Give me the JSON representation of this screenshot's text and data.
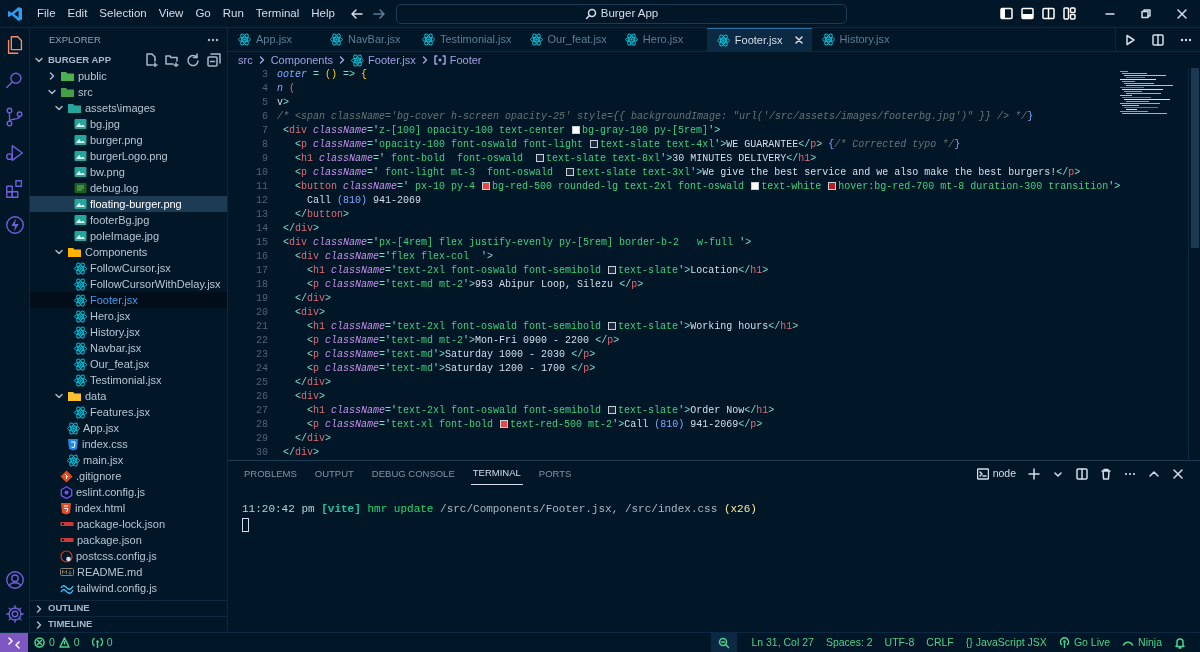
{
  "menu": [
    "File",
    "Edit",
    "Selection",
    "View",
    "Go",
    "Run",
    "Terminal",
    "Help"
  ],
  "command_center": {
    "label": "Burger App"
  },
  "activity_bar": [
    {
      "kind": "explorer",
      "selected": true
    },
    {
      "kind": "search",
      "selected": false
    },
    {
      "kind": "source",
      "selected": false
    },
    {
      "kind": "debug",
      "selected": false
    },
    {
      "kind": "extensions",
      "selected": false
    },
    {
      "kind": "lightning",
      "selected": false
    }
  ],
  "activity_bottom": [
    {
      "kind": "account"
    },
    {
      "kind": "settings"
    }
  ],
  "sidebar": {
    "title": "EXPLORER",
    "project": "BURGER APP",
    "tree": [
      {
        "label": "public",
        "kind": "folder",
        "color": "#4caf50",
        "expanded": false,
        "selected": false,
        "active": false
      },
      {
        "label": "src",
        "kind": "folder",
        "color": "#43a047",
        "expanded": true,
        "selected": false,
        "active": false,
        "children": [
          {
            "label": "assets\\images",
            "kind": "folder",
            "color": "#26a69a",
            "expanded": true,
            "selected": false,
            "active": false,
            "children": [
              {
                "label": "bg.jpg",
                "kind": "image",
                "selected": false,
                "active": false
              },
              {
                "label": "burger.png",
                "kind": "image",
                "selected": false,
                "active": false
              },
              {
                "label": "burgerLogo.png",
                "kind": "image",
                "selected": false,
                "active": false
              },
              {
                "label": "bw.png",
                "kind": "image",
                "selected": false,
                "active": false
              },
              {
                "label": "debug.log",
                "kind": "log",
                "selected": false,
                "active": false
              },
              {
                "label": "floating-burger.png",
                "kind": "image",
                "selected": true,
                "active": false
              },
              {
                "label": "footerBg.jpg",
                "kind": "image",
                "selected": false,
                "active": false
              },
              {
                "label": "poleImage.jpg",
                "kind": "image",
                "selected": false,
                "active": false
              }
            ]
          },
          {
            "label": "Components",
            "kind": "folder",
            "color": "#ffb300",
            "expanded": true,
            "selected": false,
            "active": false,
            "children": [
              {
                "label": "FollowCursor.jsx",
                "kind": "react",
                "selected": false,
                "active": false
              },
              {
                "label": "FollowCursorWithDelay.jsx",
                "kind": "react",
                "selected": false,
                "active": false
              },
              {
                "label": "Footer.jsx",
                "kind": "react",
                "selected": false,
                "active": true
              },
              {
                "label": "Hero.jsx",
                "kind": "react",
                "selected": false,
                "active": false
              },
              {
                "label": "History.jsx",
                "kind": "react",
                "selected": false,
                "active": false
              },
              {
                "label": "Navbar.jsx",
                "kind": "react",
                "selected": false,
                "active": false
              },
              {
                "label": "Our_feat.jsx",
                "kind": "react",
                "selected": false,
                "active": false
              },
              {
                "label": "Testimonial.jsx",
                "kind": "react",
                "selected": false,
                "active": false
              }
            ]
          },
          {
            "label": "data",
            "kind": "folder",
            "color": "#fbc02d",
            "expanded": true,
            "selected": false,
            "active": false,
            "children": [
              {
                "label": "Features.jsx",
                "kind": "react",
                "selected": false,
                "active": false
              }
            ]
          },
          {
            "label": "App.jsx",
            "kind": "react",
            "selected": false,
            "active": false
          },
          {
            "label": "index.css",
            "kind": "css",
            "selected": false,
            "active": false
          },
          {
            "label": "main.jsx",
            "kind": "react",
            "selected": false,
            "active": false
          }
        ]
      },
      {
        "label": ".gitignore",
        "kind": "git",
        "selected": false,
        "active": false
      },
      {
        "label": "eslint.config.js",
        "kind": "eslint",
        "selected": false,
        "active": false
      },
      {
        "label": "index.html",
        "kind": "html",
        "selected": false,
        "active": false
      },
      {
        "label": "package-lock.json",
        "kind": "npm",
        "selected": false,
        "active": false
      },
      {
        "label": "package.json",
        "kind": "npm",
        "selected": false,
        "active": false
      },
      {
        "label": "postcss.config.js",
        "kind": "postcss",
        "selected": false,
        "active": false
      },
      {
        "label": "README.md",
        "kind": "markdown",
        "selected": false,
        "active": false
      },
      {
        "label": "tailwind.config.js",
        "kind": "tailwind",
        "selected": false,
        "active": false
      }
    ],
    "sections": [
      {
        "label": "OUTLINE",
        "expanded": false
      },
      {
        "label": "TIMELINE",
        "expanded": false
      }
    ]
  },
  "tabs": [
    {
      "label": "App.jsx",
      "selected": false
    },
    {
      "label": "NavBar.jsx",
      "selected": false
    },
    {
      "label": "Testimonial.jsx",
      "selected": false
    },
    {
      "label": "Our_feat.jsx",
      "selected": false
    },
    {
      "label": "Hero.jsx",
      "selected": false
    },
    {
      "label": "Footer.jsx",
      "selected": true
    },
    {
      "label": "History.jsx",
      "selected": false
    }
  ],
  "breadcrumb": [
    {
      "kind": "folder",
      "label": "src"
    },
    {
      "kind": "folder",
      "label": "Components"
    },
    {
      "kind": "file",
      "label": "Footer.jsx"
    },
    {
      "kind": "symbol",
      "label": "Footer"
    }
  ],
  "editor": {
    "lines": [
      {
        "number": "3",
        "tokens": [
          {
            "kind": "name",
            "text": "ooter"
          },
          {
            "kind": "punct",
            "text": " = "
          },
          {
            "kind": "paren",
            "text": "()"
          },
          {
            "kind": "punct",
            "text": " => "
          },
          {
            "kind": "paren",
            "text": "{"
          }
        ]
      },
      {
        "number": "4",
        "tokens": [
          {
            "kind": "name",
            "text": "n"
          },
          {
            "kind": "tag",
            "text": " ("
          }
        ]
      },
      {
        "number": "5",
        "tokens": [
          {
            "kind": "text",
            "text": "v"
          },
          {
            "kind": "punct",
            "text": ">"
          }
        ]
      },
      {
        "number": "6",
        "tokens": [
          {
            "kind": "comment",
            "text": "/* <span className='bg-cover h-screen opacity-25' style={{ backgroundImage: \"url('/src/assets/images/footerbg.jpg')\" }} /> */"
          },
          {
            "kind": "brace",
            "text": "}"
          }
        ]
      },
      {
        "number": "7",
        "tokens": [
          {
            "kind": "punct",
            "text": " <"
          },
          {
            "kind": "tag",
            "text": "div"
          },
          {
            "kind": "attr",
            "text": " className"
          },
          {
            "kind": "punct",
            "text": "='"
          },
          {
            "kind": "string",
            "text": "z-[100] opacity-100 text-center "
          },
          {
            "kind": "swatch",
            "color": "#ffffff"
          },
          {
            "kind": "string",
            "text": "bg-gray-100 py-[5rem]"
          },
          {
            "kind": "punct",
            "text": "'>"
          }
        ]
      },
      {
        "number": "8",
        "tokens": [
          {
            "kind": "punct",
            "text": "   <"
          },
          {
            "kind": "tag",
            "text": "p"
          },
          {
            "kind": "attr",
            "text": " className"
          },
          {
            "kind": "punct",
            "text": "='"
          },
          {
            "kind": "string",
            "text": "opacity-100 font-oswald font-light "
          },
          {
            "kind": "swatch",
            "color": "#1e293b"
          },
          {
            "kind": "string",
            "text": "text-slate text-4xl"
          },
          {
            "kind": "punct",
            "text": "'>"
          },
          {
            "kind": "text",
            "text": "WE GUARANTEE"
          },
          {
            "kind": "punct",
            "text": "</"
          },
          {
            "kind": "tag",
            "text": "p"
          },
          {
            "kind": "punct",
            "text": "> "
          },
          {
            "kind": "brace",
            "text": "{"
          },
          {
            "kind": "comment",
            "text": "/* Corrected typo */"
          },
          {
            "kind": "brace",
            "text": "}"
          }
        ]
      },
      {
        "number": "9",
        "tokens": [
          {
            "kind": "punct",
            "text": "   <"
          },
          {
            "kind": "tag",
            "text": "h1"
          },
          {
            "kind": "attr",
            "text": " className"
          },
          {
            "kind": "punct",
            "text": "='"
          },
          {
            "kind": "string",
            "text": " font-bold  font-oswald  "
          },
          {
            "kind": "swatch",
            "color": "#1e293b"
          },
          {
            "kind": "string",
            "text": "text-slate text-8xl"
          },
          {
            "kind": "punct",
            "text": "'>"
          },
          {
            "kind": "text",
            "text": "30 MINUTES DELIVERY"
          },
          {
            "kind": "punct",
            "text": "</"
          },
          {
            "kind": "tag",
            "text": "h1"
          },
          {
            "kind": "punct",
            "text": ">"
          }
        ]
      },
      {
        "number": "10",
        "tokens": [
          {
            "kind": "punct",
            "text": "   <"
          },
          {
            "kind": "tag",
            "text": "p"
          },
          {
            "kind": "attr",
            "text": " className"
          },
          {
            "kind": "punct",
            "text": "='"
          },
          {
            "kind": "string",
            "text": " font-light mt-3  font-oswald  "
          },
          {
            "kind": "swatch",
            "color": "#1e293b"
          },
          {
            "kind": "string",
            "text": "text-slate text-3xl"
          },
          {
            "kind": "punct",
            "text": "'>"
          },
          {
            "kind": "text",
            "text": "We give the best service and we also make the best burgers!"
          },
          {
            "kind": "punct",
            "text": "</"
          },
          {
            "kind": "tag",
            "text": "p"
          },
          {
            "kind": "punct",
            "text": ">"
          }
        ]
      },
      {
        "number": "11",
        "tokens": [
          {
            "kind": "punct",
            "text": "   <"
          },
          {
            "kind": "tag",
            "text": "button"
          },
          {
            "kind": "attr",
            "text": " className"
          },
          {
            "kind": "punct",
            "text": "='"
          },
          {
            "kind": "string",
            "text": " px-10 py-4 "
          },
          {
            "kind": "swatch",
            "color": "#ef4444"
          },
          {
            "kind": "string",
            "text": "bg-red-500 rounded-lg text-2xl font-oswald "
          },
          {
            "kind": "swatch",
            "color": "#ffffff"
          },
          {
            "kind": "string",
            "text": "text-white "
          },
          {
            "kind": "swatch",
            "color": "#b91c1c"
          },
          {
            "kind": "string",
            "text": "hover:bg-red-700 mt-8 duration-300 transition"
          },
          {
            "kind": "punct",
            "text": "'>"
          }
        ]
      },
      {
        "number": "12",
        "tokens": [
          {
            "kind": "text",
            "text": "     Call "
          },
          {
            "kind": "brace",
            "text": "(810)"
          },
          {
            "kind": "text",
            "text": " 941-2069"
          }
        ]
      },
      {
        "number": "13",
        "tokens": [
          {
            "kind": "punct",
            "text": "   </"
          },
          {
            "kind": "tag",
            "text": "button"
          },
          {
            "kind": "punct",
            "text": ">"
          }
        ]
      },
      {
        "number": "14",
        "tokens": [
          {
            "kind": "punct",
            "text": " </"
          },
          {
            "kind": "tag",
            "text": "div"
          },
          {
            "kind": "punct",
            "text": ">"
          }
        ]
      },
      {
        "number": "15",
        "tokens": [
          {
            "kind": "punct",
            "text": " <"
          },
          {
            "kind": "tag",
            "text": "div"
          },
          {
            "kind": "attr",
            "text": " className"
          },
          {
            "kind": "punct",
            "text": "='"
          },
          {
            "kind": "string",
            "text": "px-[4rem] flex justify-evenly py-[5rem] border-b-2   w-full "
          },
          {
            "kind": "punct",
            "text": "'>"
          }
        ]
      },
      {
        "number": "16",
        "tokens": [
          {
            "kind": "punct",
            "text": "   <"
          },
          {
            "kind": "tag",
            "text": "div"
          },
          {
            "kind": "attr",
            "text": " className"
          },
          {
            "kind": "punct",
            "text": "='"
          },
          {
            "kind": "string",
            "text": "flex flex-col  "
          },
          {
            "kind": "punct",
            "text": "'>"
          }
        ]
      },
      {
        "number": "17",
        "tokens": [
          {
            "kind": "punct",
            "text": "     <"
          },
          {
            "kind": "tag",
            "text": "h1"
          },
          {
            "kind": "attr",
            "text": " className"
          },
          {
            "kind": "punct",
            "text": "='"
          },
          {
            "kind": "string",
            "text": "text-2xl font-oswald font-semibold "
          },
          {
            "kind": "swatch",
            "color": "#1e293b"
          },
          {
            "kind": "string",
            "text": "text-slate"
          },
          {
            "kind": "punct",
            "text": "'>"
          },
          {
            "kind": "text",
            "text": "Location"
          },
          {
            "kind": "punct",
            "text": "</"
          },
          {
            "kind": "tag",
            "text": "h1"
          },
          {
            "kind": "punct",
            "text": ">"
          }
        ]
      },
      {
        "number": "18",
        "tokens": [
          {
            "kind": "punct",
            "text": "     <"
          },
          {
            "kind": "tag",
            "text": "p"
          },
          {
            "kind": "attr",
            "text": " className"
          },
          {
            "kind": "punct",
            "text": "='"
          },
          {
            "kind": "string",
            "text": "text-md mt-2"
          },
          {
            "kind": "punct",
            "text": "'>"
          },
          {
            "kind": "text",
            "text": "953 Abipur Loop, Silezu "
          },
          {
            "kind": "punct",
            "text": "</"
          },
          {
            "kind": "tag",
            "text": "p"
          },
          {
            "kind": "punct",
            "text": ">"
          }
        ]
      },
      {
        "number": "19",
        "tokens": [
          {
            "kind": "punct",
            "text": "   </"
          },
          {
            "kind": "tag",
            "text": "div"
          },
          {
            "kind": "punct",
            "text": ">"
          }
        ]
      },
      {
        "number": "20",
        "tokens": [
          {
            "kind": "punct",
            "text": "   <"
          },
          {
            "kind": "tag",
            "text": "div"
          },
          {
            "kind": "punct",
            "text": ">"
          }
        ]
      },
      {
        "number": "21",
        "tokens": [
          {
            "kind": "punct",
            "text": "     <"
          },
          {
            "kind": "tag",
            "text": "h1"
          },
          {
            "kind": "attr",
            "text": " className"
          },
          {
            "kind": "punct",
            "text": "='"
          },
          {
            "kind": "string",
            "text": "text-2xl font-oswald font-semibold "
          },
          {
            "kind": "swatch",
            "color": "#1e293b"
          },
          {
            "kind": "string",
            "text": "text-slate"
          },
          {
            "kind": "punct",
            "text": "'>"
          },
          {
            "kind": "text",
            "text": "Working hours"
          },
          {
            "kind": "punct",
            "text": "</"
          },
          {
            "kind": "tag",
            "text": "h1"
          },
          {
            "kind": "punct",
            "text": ">"
          }
        ]
      },
      {
        "number": "22",
        "tokens": [
          {
            "kind": "punct",
            "text": "     <"
          },
          {
            "kind": "tag",
            "text": "p"
          },
          {
            "kind": "attr",
            "text": " className"
          },
          {
            "kind": "punct",
            "text": "='"
          },
          {
            "kind": "string",
            "text": "text-md mt-2"
          },
          {
            "kind": "punct",
            "text": "'>"
          },
          {
            "kind": "text",
            "text": "Mon-Fri 0900 - 2200 "
          },
          {
            "kind": "punct",
            "text": "</"
          },
          {
            "kind": "tag",
            "text": "p"
          },
          {
            "kind": "punct",
            "text": ">"
          }
        ]
      },
      {
        "number": "23",
        "tokens": [
          {
            "kind": "punct",
            "text": "     <"
          },
          {
            "kind": "tag",
            "text": "p"
          },
          {
            "kind": "attr",
            "text": " className"
          },
          {
            "kind": "punct",
            "text": "='"
          },
          {
            "kind": "string",
            "text": "text-md"
          },
          {
            "kind": "punct",
            "text": "'>"
          },
          {
            "kind": "text",
            "text": "Saturday 1000 - 2030 "
          },
          {
            "kind": "punct",
            "text": "</"
          },
          {
            "kind": "tag",
            "text": "p"
          },
          {
            "kind": "punct",
            "text": ">"
          }
        ]
      },
      {
        "number": "24",
        "tokens": [
          {
            "kind": "punct",
            "text": "     <"
          },
          {
            "kind": "tag",
            "text": "p"
          },
          {
            "kind": "attr",
            "text": " className"
          },
          {
            "kind": "punct",
            "text": "='"
          },
          {
            "kind": "string",
            "text": "text-md"
          },
          {
            "kind": "punct",
            "text": "'>"
          },
          {
            "kind": "text",
            "text": "Saturday 1200 - 1700 "
          },
          {
            "kind": "punct",
            "text": "</"
          },
          {
            "kind": "tag",
            "text": "p"
          },
          {
            "kind": "punct",
            "text": ">"
          }
        ]
      },
      {
        "number": "25",
        "tokens": [
          {
            "kind": "punct",
            "text": "   </"
          },
          {
            "kind": "tag",
            "text": "div"
          },
          {
            "kind": "punct",
            "text": ">"
          }
        ]
      },
      {
        "number": "26",
        "tokens": [
          {
            "kind": "punct",
            "text": "   <"
          },
          {
            "kind": "tag",
            "text": "div"
          },
          {
            "kind": "punct",
            "text": ">"
          }
        ]
      },
      {
        "number": "27",
        "tokens": [
          {
            "kind": "punct",
            "text": "     <"
          },
          {
            "kind": "tag",
            "text": "h1"
          },
          {
            "kind": "attr",
            "text": " className"
          },
          {
            "kind": "punct",
            "text": "='"
          },
          {
            "kind": "string",
            "text": "text-2xl font-oswald font-semibold "
          },
          {
            "kind": "swatch",
            "color": "#1e293b"
          },
          {
            "kind": "string",
            "text": "text-slate"
          },
          {
            "kind": "punct",
            "text": "'>"
          },
          {
            "kind": "text",
            "text": "Order Now"
          },
          {
            "kind": "punct",
            "text": "</"
          },
          {
            "kind": "tag",
            "text": "h1"
          },
          {
            "kind": "punct",
            "text": ">"
          }
        ]
      },
      {
        "number": "28",
        "tokens": [
          {
            "kind": "punct",
            "text": "     <"
          },
          {
            "kind": "tag",
            "text": "p"
          },
          {
            "kind": "attr",
            "text": " className"
          },
          {
            "kind": "punct",
            "text": "='"
          },
          {
            "kind": "string",
            "text": "text-xl font-bold "
          },
          {
            "kind": "swatch",
            "color": "#ef4444"
          },
          {
            "kind": "string",
            "text": "text-red-500 mt-2"
          },
          {
            "kind": "punct",
            "text": "'>"
          },
          {
            "kind": "text",
            "text": "Call "
          },
          {
            "kind": "brace",
            "text": "(810)"
          },
          {
            "kind": "text",
            "text": " 941-2069"
          },
          {
            "kind": "punct",
            "text": "</"
          },
          {
            "kind": "tag",
            "text": "p"
          },
          {
            "kind": "punct",
            "text": ">"
          }
        ]
      },
      {
        "number": "29",
        "tokens": [
          {
            "kind": "punct",
            "text": "   </"
          },
          {
            "kind": "tag",
            "text": "div"
          },
          {
            "kind": "punct",
            "text": ">"
          }
        ]
      },
      {
        "number": "30",
        "tokens": [
          {
            "kind": "punct",
            "text": " </"
          },
          {
            "kind": "tag",
            "text": "div"
          },
          {
            "kind": "punct",
            "text": ">"
          }
        ]
      }
    ]
  },
  "panel": {
    "tabs": [
      {
        "label": "PROBLEMS",
        "selected": false
      },
      {
        "label": "OUTPUT",
        "selected": false
      },
      {
        "label": "DEBUG CONSOLE",
        "selected": false
      },
      {
        "label": "TERMINAL",
        "selected": true
      },
      {
        "label": "PORTS",
        "selected": false
      }
    ],
    "terminal_name": "node",
    "lines": [
      {
        "tokens": [
          {
            "kind": "time",
            "text": "11:20:42 pm "
          },
          {
            "kind": "tag",
            "text": "[vite]"
          },
          {
            "kind": "message",
            "text": " hmr update "
          },
          {
            "kind": "path",
            "text": "/src/Components/Footer.jsx, /src/index.css "
          },
          {
            "kind": "count",
            "text": "(x26)"
          }
        ]
      }
    ]
  },
  "status_bar": {
    "errors": "0",
    "warnings": "0",
    "ports": "0",
    "items": [
      {
        "kind": "zoom"
      },
      {
        "kind": "text",
        "label": "Ln 31, Col 27"
      },
      {
        "kind": "text",
        "label": "Spaces: 2"
      },
      {
        "kind": "text",
        "label": "UTF-8"
      },
      {
        "kind": "text",
        "label": "CRLF"
      },
      {
        "kind": "text",
        "label": "{} JavaScript JSX"
      },
      {
        "kind": "live",
        "label": "Go Live"
      },
      {
        "kind": "ninja",
        "label": "Ninja"
      },
      {
        "kind": "bell"
      }
    ]
  }
}
